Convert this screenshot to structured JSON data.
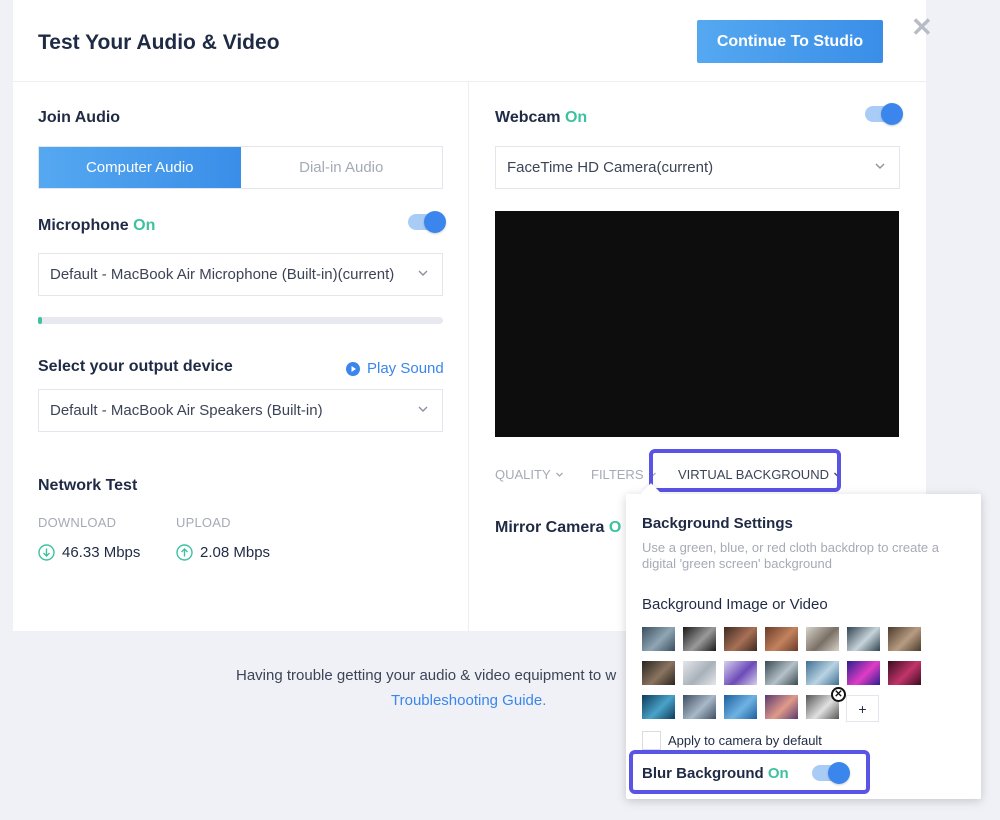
{
  "header": {
    "title": "Test Your Audio & Video",
    "continue_label": "Continue To Studio",
    "close_glyph": "✕"
  },
  "audio": {
    "join_title": "Join Audio",
    "tabs": [
      {
        "label": "Computer Audio",
        "active": true
      },
      {
        "label": "Dial-in Audio",
        "active": false
      }
    ],
    "microphone_label": "Microphone",
    "microphone_state": "On",
    "microphone_device": "Default - MacBook Air Microphone (Built-in)(current)",
    "mic_level": 0.01,
    "output_title": "Select your output device",
    "play_sound": "Play Sound",
    "output_device": "Default - MacBook Air Speakers (Built-in)"
  },
  "network": {
    "title": "Network Test",
    "download_label": "DOWNLOAD",
    "download_value": "46.33 Mbps",
    "upload_label": "UPLOAD",
    "upload_value": "2.08 Mbps"
  },
  "video": {
    "webcam_label": "Webcam",
    "webcam_state": "On",
    "camera_device": "FaceTime HD Camera(current)",
    "menu": {
      "quality": "QUALITY",
      "filters": "FILTERS",
      "virtual_background": "VIRTUAL BACKGROUND"
    },
    "mirror_label": "Mirror Camera",
    "mirror_state": "O"
  },
  "footer": {
    "trouble_text": "Having trouble getting your audio & video equipment to w",
    "link": "Troubleshooting Guide."
  },
  "background_settings": {
    "title": "Background Settings",
    "description": "Use a green, blue, or red cloth backdrop to create a digital 'green screen' background",
    "subtitle": "Background Image or Video",
    "add_label": "+",
    "remove_glyph": "✕",
    "apply_label": "Apply to camera by default",
    "apply_checked": false,
    "blur_label": "Blur Background",
    "blur_state": "On"
  },
  "colors": {
    "accent": "#3b86ec",
    "on_green": "#3ec1a0",
    "highlight": "#5a54e6"
  },
  "thumbnails": [
    {
      "name": "bg-thumb-library",
      "c1": "#3a4d5e",
      "c2": "#8fa6b4"
    },
    {
      "name": "bg-thumb-dark-office",
      "c1": "#1a1a1a",
      "c2": "#9a9a9a"
    },
    {
      "name": "bg-thumb-tv-room",
      "c1": "#3d2a22",
      "c2": "#a87056"
    },
    {
      "name": "bg-thumb-brick-room",
      "c1": "#6b3c2a",
      "c2": "#c2825e"
    },
    {
      "name": "bg-thumb-bright-room",
      "c1": "#d8d3ca",
      "c2": "#7a6f65"
    },
    {
      "name": "bg-thumb-glass-office",
      "c1": "#2f4350",
      "c2": "#c7d3da"
    },
    {
      "name": "bg-thumb-loft",
      "c1": "#4b3a2c",
      "c2": "#b89c82"
    },
    {
      "name": "bg-thumb-bookshelf",
      "c1": "#2a2520",
      "c2": "#8a7460"
    },
    {
      "name": "bg-thumb-white-room",
      "c1": "#e5e7ea",
      "c2": "#a8b0b9"
    },
    {
      "name": "bg-thumb-purple-figure",
      "c1": "#d6d0ef",
      "c2": "#6c4bb8"
    },
    {
      "name": "bg-thumb-meeting-room",
      "c1": "#394a54",
      "c2": "#b5c1c8"
    },
    {
      "name": "bg-thumb-city-window",
      "c1": "#3f6f92",
      "c2": "#b9d3e3"
    },
    {
      "name": "bg-thumb-neon",
      "c1": "#2a1f8f",
      "c2": "#e03cc5"
    },
    {
      "name": "bg-thumb-red-stage",
      "c1": "#3a0b20",
      "c2": "#c1356a"
    },
    {
      "name": "bg-thumb-ocean",
      "c1": "#0d3a5a",
      "c2": "#4aa3c9"
    },
    {
      "name": "bg-thumb-mountains",
      "c1": "#3d4f63",
      "c2": "#a9b8c7"
    },
    {
      "name": "bg-thumb-blue-abstract",
      "c1": "#1d5f9e",
      "c2": "#6fb2e3"
    },
    {
      "name": "bg-thumb-sunset",
      "c1": "#5b3a6e",
      "c2": "#e09a8a"
    },
    {
      "name": "bg-thumb-custom-upload",
      "c1": "#555555",
      "c2": "#e0e0e0"
    }
  ]
}
